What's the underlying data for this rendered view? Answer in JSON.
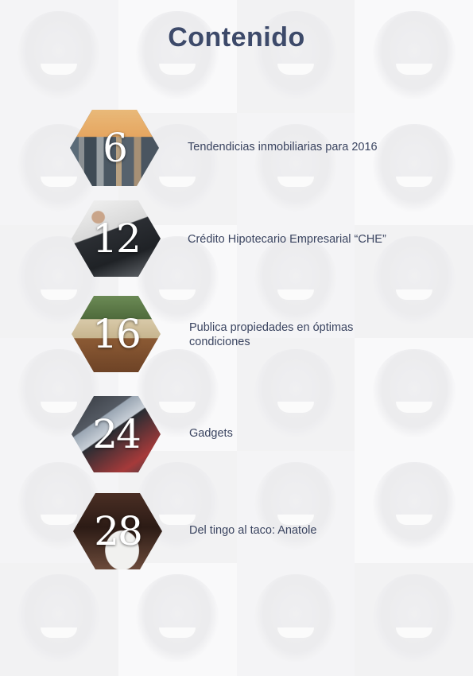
{
  "page": {
    "title": "Contenido"
  },
  "entries": [
    {
      "number": "6",
      "text": "Tendendicias inmobiliarias para 2016",
      "image": "city-skyline-photo"
    },
    {
      "number": "12",
      "text": "Crédito Hipotecario Empresarial “CHE”",
      "image": "businessman-photo"
    },
    {
      "number": "16",
      "text": "Publica propiedades en óptimas condiciones",
      "image": "house-patio-photo"
    },
    {
      "number": "24",
      "text": "Gadgets",
      "image": "tablet-gadgets-photo"
    },
    {
      "number": "28",
      "text": "Del tingo al taco: Anatole",
      "image": "food-plate-photo"
    }
  ],
  "colors": {
    "title": "#3d4a6a",
    "text": "#3a4460",
    "numbers": "#ffffff"
  }
}
